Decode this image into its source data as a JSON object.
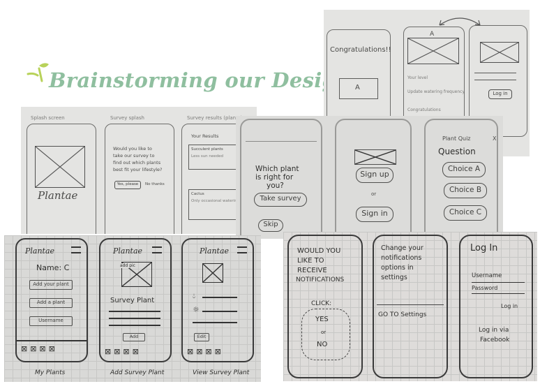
{
  "title": "Brainstorming our Design",
  "colors": {
    "title": "#8fbf9f",
    "sprig": "#b8d25a"
  },
  "top_right_photo": {
    "phone1_text": "Congratulations!!",
    "phone1_letter": "A",
    "phone1_line1": "Your level",
    "phone1_line2": "Update watering frequency",
    "phone1_line3": "Congratulations",
    "phone2_letter": "A",
    "phone3_button": "Log in"
  },
  "left_photo": {
    "label1": "Splash screen",
    "label2": "Survey splash",
    "label3": "Survey results (plants)",
    "logo": "Plantae",
    "survey_text": [
      "Would you like to",
      "take our survey to",
      "find out which plants",
      "best fit your lifestyle?"
    ],
    "btn_yes": "Yes, please",
    "btn_no": "No thanks",
    "results_title": "Your Results",
    "result1": "Succulent plants",
    "result1b": "Less sun needed",
    "result2": "Cactus",
    "result2b": "Only occasional watering"
  },
  "middle_photo": {
    "question": [
      "Which plant",
      "is right for",
      "you?"
    ],
    "take_survey": "Take survey",
    "skip": "Skip",
    "sign_up": "Sign up",
    "or": "or",
    "sign_in": "Sign in",
    "quiz_header": "Plant Quiz",
    "quiz_close": "X",
    "quiz_question": "Question",
    "choice_a": "Choice A",
    "choice_b": "Choice B",
    "choice_c": "Choice C"
  },
  "bottom_left_photo": {
    "logo1": "Plantae",
    "logo2": "Plantae",
    "logo3": "Plantae",
    "name_label": "Name: C",
    "add_your_plant": "Add your plant",
    "add_a_plant": "Add a plant",
    "user_name": "Username",
    "add_pic": "add pic",
    "survey_plant": "Survey Plant",
    "add_btn": "Add",
    "edit_btn": "Edit",
    "cap1": "My Plants",
    "cap2": "Add Survey Plant",
    "cap3": "View Survey Plant"
  },
  "bottom_right_photo": {
    "notif_q": [
      "WOULD YOU",
      "LIKE TO",
      "RECEIVE",
      "NOTIFICATIONS"
    ],
    "click": "CLICK:",
    "yes": "YES",
    "or": "or",
    "no": "NO",
    "change": [
      "Change your",
      "notifications",
      "options in",
      "settings"
    ],
    "go_settings": "GO TO Settings",
    "login_title": "Log In",
    "username": "Username",
    "password": "Password",
    "login_btn": "Log in",
    "login_via": "Log in via",
    "facebook": "Facebook"
  }
}
